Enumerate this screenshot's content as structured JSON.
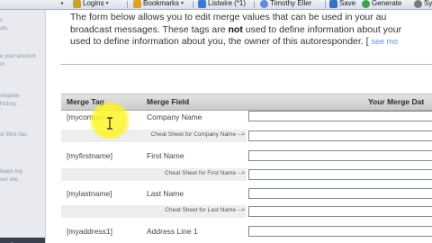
{
  "toolbar": {
    "items": [
      {
        "icon": "logins-key-icon",
        "label": "Logins",
        "color": "#c9a227"
      },
      {
        "icon": "bookmark-star-icon",
        "label": "Bookmarks",
        "color": "#e0a020"
      },
      {
        "icon": "listwire-icon",
        "label": "Listwire",
        "badge": "(*1)",
        "color": "#3a7bd5"
      },
      {
        "icon": "user-icon",
        "label": "Timothy Eller",
        "color": "#5b8dd9"
      },
      {
        "icon": "save-icon",
        "label": "Save",
        "color": "#3b6fc4"
      },
      {
        "icon": "generate-icon",
        "label": "Generate",
        "color": "#3fa34d"
      },
      {
        "icon": "sync-icon",
        "label": "Sy",
        "color": "#7a7a7a"
      }
    ]
  },
  "sidebar": {
    "lines": [
      "s",
      "ats.",
      "",
      "e your account",
      "nt.",
      "",
      "omplete",
      "history.",
      "",
      "st Wire has",
      "",
      "lways log",
      "our site."
    ],
    "bottom_label": "ent"
  },
  "intro": {
    "line1": "The form below allows you to edit merge values that can be used in your au",
    "line2": "broadcast messages. These tags are ",
    "line2_bold": "not",
    "line2_rest": " used to define information about your",
    "line3": "used to define information about you, the owner of this autoresponder. [ ",
    "see_more": "see mo"
  },
  "table": {
    "headers": {
      "tag": "Merge Tag",
      "field": "Merge Field",
      "data": "Your Merge Dat"
    },
    "rows": [
      {
        "tag": "[mycompany]",
        "label": "Company Name",
        "value": "",
        "cheat": "Cheat Sheet for Company Name -->"
      },
      {
        "tag": "[myfirstname]",
        "label": "First Name",
        "value": "",
        "cheat": "Cheat Sheet for First Name -->"
      },
      {
        "tag": "[mylastname]",
        "label": "Last Name",
        "value": "",
        "cheat": "Cheat Sheet for Last Name -->"
      },
      {
        "tag": "[myaddress1]",
        "label": "Address Line 1",
        "value": ""
      }
    ]
  },
  "colors": {
    "highlight": "#fff33c",
    "link": "#6c8cd5",
    "header_bg": "#d4d4d4"
  }
}
